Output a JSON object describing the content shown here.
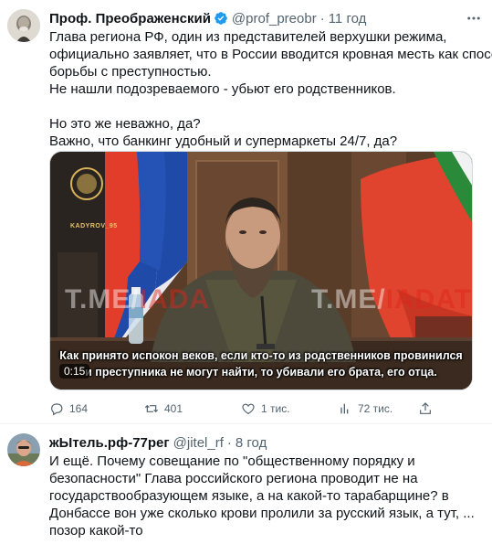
{
  "main_tweet": {
    "author_name": "Проф. Преображенский",
    "handle": "@prof_preobr",
    "separator": "·",
    "time": "11 год",
    "more_label": "···",
    "text_lines": [
      "Глава региона РФ, один из представителей верхушки режима,",
      "официально заявляет, что в России вводится кровная месть как способ",
      "борьбы с преступностью.",
      "Не нашли подозреваемого - убьют его родственников.",
      "",
      "Но это же неважно, да?",
      "Важно, что банкинг удобный и супермаркеты 24/7, да?"
    ],
    "video": {
      "logo_text": "KADYROV_95",
      "watermark_left_prefix": "T.ME/",
      "watermark_left_accent": "IADA",
      "watermark_right_prefix": "T.ME/",
      "watermark_right_accent": "IADAT",
      "caption_line1": "Как принято испокон веков, если кто-то из родственников провинился",
      "caption_line2": "и преступника не могут найти, то убивали его брата, его отца.",
      "timestamp": "0:15"
    },
    "actions": {
      "replies": "164",
      "retweets": "401",
      "likes": "1 тис.",
      "views": "72 тис."
    }
  },
  "reply_tweet": {
    "author_name": "жЫтель.рф-77рег",
    "handle": "@jitel_rf",
    "separator": "·",
    "time": "8 год",
    "text_lines": [
      "И ещё. Почему совещание по \"общественному порядку и",
      "безопасности\" Глава российского региона проводит не на",
      "государствообразующем языке, а на какой-то тарабарщине? в",
      "Донбассе вон уже сколько крови пролили за русский язык,  а тут, ...",
      "позор какой-то"
    ]
  },
  "colors": {
    "text_primary": "#0f1419",
    "text_secondary": "#536471",
    "verified_blue": "#1d9bf0",
    "border": "#eff3f4"
  },
  "icons": [
    "verified-badge-icon",
    "reply-icon",
    "retweet-icon",
    "like-icon",
    "views-icon",
    "share-icon",
    "more-icon"
  ]
}
